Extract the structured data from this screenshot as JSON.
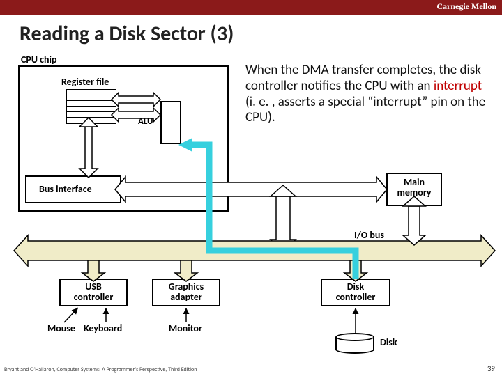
{
  "org": "Carnegie Mellon",
  "title": "Reading a Disk Sector (3)",
  "description": {
    "part1": "When the DMA transfer completes, the disk controller notifies the CPU with an ",
    "highlight": "interrupt",
    "part2": " (i. e. , asserts a special “interrupt” pin on the CPU)."
  },
  "labels": {
    "cpu_chip": "CPU chip",
    "register_file": "Register file",
    "alu": "ALU",
    "bus_interface": "Bus interface",
    "main_memory_l1": "Main",
    "main_memory_l2": "memory",
    "io_bus": "I/O bus",
    "usb_l1": "USB",
    "usb_l2": "controller",
    "gfx_l1": "Graphics",
    "gfx_l2": "adapter",
    "disk_ctrl_l1": "Disk",
    "disk_ctrl_l2": "controller",
    "mouse": "Mouse",
    "keyboard": "Keyboard",
    "monitor": "Monitor",
    "disk": "Disk"
  },
  "footer": "Bryant and O'Hallaron, Computer Systems: A Programmer's Perspective, Third Edition",
  "page": "39",
  "colors": {
    "header": "#8b1a1a",
    "interrupt_highlight": "#c00000",
    "io_bus_fill": "#f0ecc8",
    "interrupt_path": "#36d0de"
  }
}
